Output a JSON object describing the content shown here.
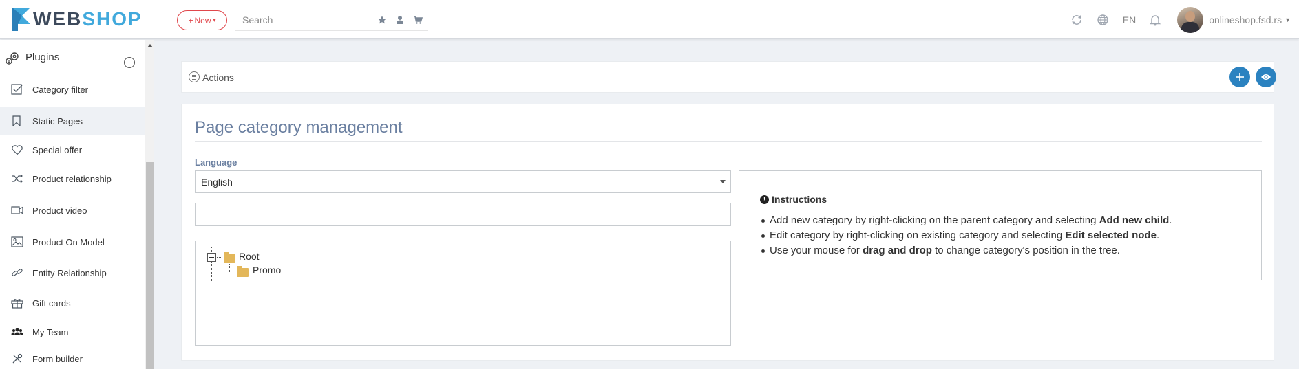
{
  "header": {
    "logo": {
      "part1": "WEB",
      "part2": "SHOP"
    },
    "new_button": "New",
    "search_placeholder": "Search",
    "language": "EN",
    "username": "onlineshop.fsd.rs"
  },
  "sidebar": {
    "section": "Plugins",
    "items": [
      {
        "label": "Category filter",
        "icon": "checkbox-icon"
      },
      {
        "label": "Static Pages",
        "icon": "bookmark-icon",
        "active": true
      },
      {
        "label": "Special offer",
        "icon": "heart-icon"
      },
      {
        "label": "Product relationship",
        "icon": "shuffle-icon"
      },
      {
        "label": "Product video",
        "icon": "video-icon"
      },
      {
        "label": "Product On Model",
        "icon": "image-icon"
      },
      {
        "label": "Entity Relationship",
        "icon": "link-icon"
      },
      {
        "label": "Gift cards",
        "icon": "gift-icon"
      },
      {
        "label": "My Team",
        "icon": "users-icon"
      },
      {
        "label": "Form builder",
        "icon": "tools-icon"
      }
    ]
  },
  "actions": {
    "label": "Actions"
  },
  "page": {
    "title": "Page category management",
    "language_label": "Language",
    "language_value": "English",
    "tree": {
      "root": "Root",
      "child": "Promo"
    }
  },
  "instructions": {
    "title": "Instructions",
    "items": [
      {
        "pre": "Add new category by right-clicking on the parent category and selecting ",
        "bold": "Add new child",
        "post": "."
      },
      {
        "pre": "Edit category by right-clicking on existing category and selecting ",
        "bold": "Edit selected node",
        "post": "."
      },
      {
        "pre": "Use your mouse for ",
        "bold": "drag and drop",
        "post": " to change category's position in the tree."
      }
    ]
  },
  "colors": {
    "accent": "#2b82c0",
    "new_button": "#e0474c",
    "logo_dark": "#3d4a5c",
    "logo_light": "#41a9dc",
    "folder": "#e3b75a"
  }
}
